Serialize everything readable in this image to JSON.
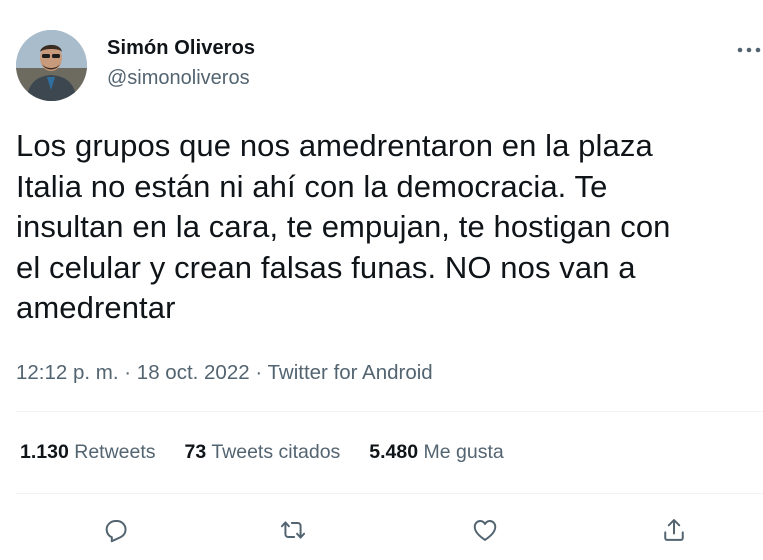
{
  "author": {
    "name": "Simón Oliveros",
    "handle": "@simonoliveros"
  },
  "tweet": {
    "text": "Los grupos que nos amedrentaron en la plaza\nItalia no están ni ahí con la democracia. Te\ninsultan en la cara, te empujan, te hostigan con\nel celular y crean falsas funas. NO nos van a\namedrentar",
    "time": "12:12 p. m.",
    "date": "18 oct. 2022",
    "source": "Twitter for Android"
  },
  "stats": {
    "retweets_num": "1.130",
    "retweets_label": "Retweets",
    "quotes_num": "73",
    "quotes_label": "Tweets citados",
    "likes_num": "5.480",
    "likes_label": "Me gusta"
  },
  "icons": {
    "more": "more-dots-icon",
    "reply": "reply-icon",
    "retweet": "retweet-icon",
    "like": "heart-icon",
    "share": "share-icon"
  },
  "colors": {
    "text": "#0f1419",
    "secondary": "#536471",
    "divider": "#eff3f4"
  }
}
